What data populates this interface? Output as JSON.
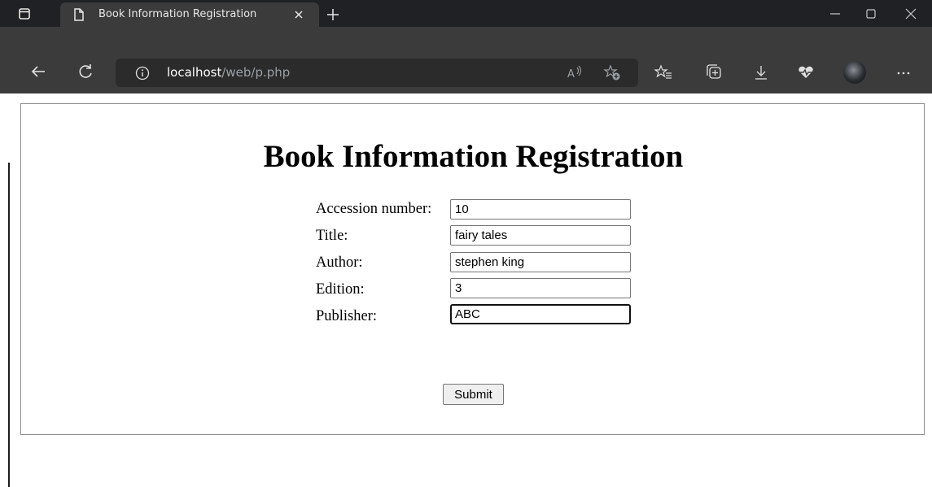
{
  "browser": {
    "tab": {
      "title": "Book Information Registration",
      "close_glyph": "×"
    },
    "new_tab_glyph": "+",
    "window_controls": [
      "minimize-icon",
      "maximize-icon",
      "close-icon"
    ],
    "address": {
      "host": "localhost",
      "path": "/web/p.php"
    },
    "toolbar_icons": [
      "back-icon",
      "refresh-icon",
      "read-aloud-icon",
      "add-favorite-icon",
      "favorites-icon",
      "collections-icon",
      "downloads-icon",
      "health-icon",
      "more-icon"
    ]
  },
  "form": {
    "heading": "Book Information Registration",
    "fields": [
      {
        "label": "Accession number:",
        "value": "10"
      },
      {
        "label": "Title:",
        "value": "fairy tales"
      },
      {
        "label": "Author:",
        "value": "stephen king"
      },
      {
        "label": "Edition:",
        "value": "3"
      },
      {
        "label": "Publisher:",
        "value": "ABC"
      }
    ],
    "submit_label": "Submit"
  }
}
